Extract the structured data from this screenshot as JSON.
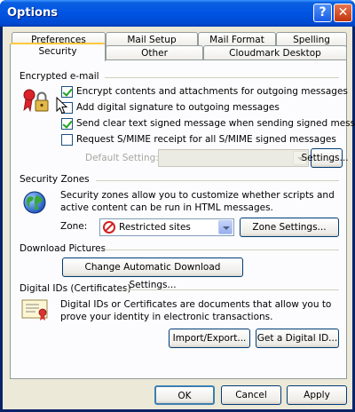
{
  "window": {
    "title": "Options",
    "help_glyph": "?",
    "close_glyph": "✕"
  },
  "tabs_row1": [
    {
      "label": "Preferences"
    },
    {
      "label": "Mail Setup"
    },
    {
      "label": "Mail Format"
    },
    {
      "label": "Spelling"
    }
  ],
  "tabs_row2": [
    {
      "label": "Security",
      "active": true
    },
    {
      "label": "Other"
    },
    {
      "label": "Cloudmark Desktop"
    }
  ],
  "encrypted": {
    "heading": "Encrypted e-mail",
    "options": [
      {
        "label": "Encrypt contents and attachments for outgoing messages",
        "checked": true
      },
      {
        "label": "Add digital signature to outgoing messages",
        "checked": false
      },
      {
        "label": "Send clear text signed message when sending signed messages",
        "checked": true
      },
      {
        "label": "Request S/MIME receipt for all S/MIME signed messages",
        "checked": false
      }
    ],
    "default_setting_label": "Default Setting:",
    "default_setting_value": "",
    "settings_button": "Settings..."
  },
  "zones": {
    "heading": "Security Zones",
    "description": "Security zones allow you to customize whether scripts and active content can be run in HTML messages.",
    "zone_label": "Zone:",
    "zone_value": "Restricted sites",
    "zone_settings_button": "Zone Settings..."
  },
  "download": {
    "heading": "Download Pictures",
    "button": "Change Automatic Download Settings..."
  },
  "digital_ids": {
    "heading": "Digital IDs (Certificates)",
    "description": "Digital IDs or Certificates are documents that allow you to prove your identity in electronic transactions.",
    "import_export_button": "Import/Export...",
    "get_id_button": "Get a Digital ID..."
  },
  "footer": {
    "ok": "OK",
    "cancel": "Cancel",
    "apply": "Apply"
  }
}
